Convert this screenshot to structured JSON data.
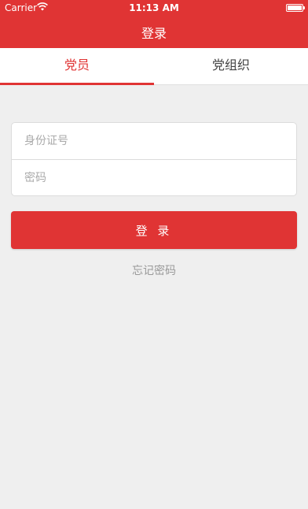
{
  "status_bar": {
    "carrier": "Carrier",
    "time": "11:13 AM"
  },
  "nav": {
    "title": "登录"
  },
  "tabs": [
    {
      "label": "党员",
      "active": true
    },
    {
      "label": "党组织",
      "active": false
    }
  ],
  "form": {
    "id_placeholder": "身份证号",
    "password_placeholder": "密码"
  },
  "login_button_label": "登 录",
  "forgot_password": "忘记密码",
  "colors": {
    "accent": "#e03434",
    "background": "#efefef"
  }
}
